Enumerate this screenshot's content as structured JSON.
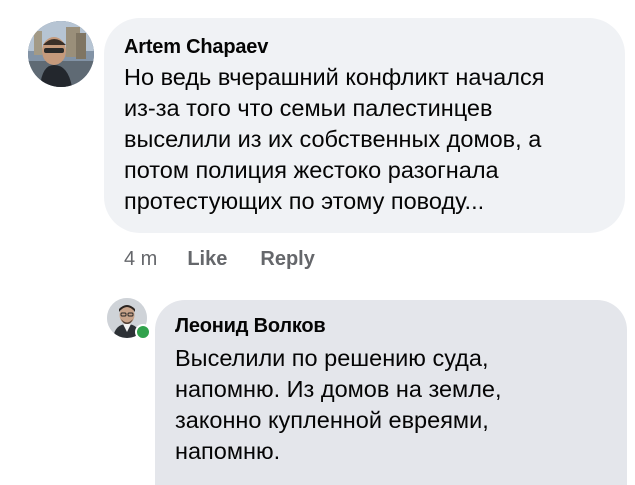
{
  "comments": [
    {
      "author": "Artem Chapaev",
      "text": "Но ведь вчерашний конфликт начался\nиз-за того что семьи палестинцев\nвыселили из их собственных домов, а\nпотом полиция жестоко разогнала\nпротестующих по этому поводу...",
      "time": "4 m",
      "like_label": "Like",
      "reply_label": "Reply"
    },
    {
      "author": "Леонид Волков",
      "text": "Выселили по решению суда,\nнапомню. Из домов на земле,\nзаконно купленной евреями,\nнапомню.",
      "online": true
    }
  ],
  "colors": {
    "bubble_primary": "#f0f2f5",
    "bubble_reply": "#e4e6eb",
    "text": "#050505",
    "muted": "#65676b",
    "online": "#31a24c"
  },
  "icons": {
    "avatar1": "user-photo-avatar",
    "avatar2": "user-photo-avatar",
    "presence": "online-status-dot"
  }
}
